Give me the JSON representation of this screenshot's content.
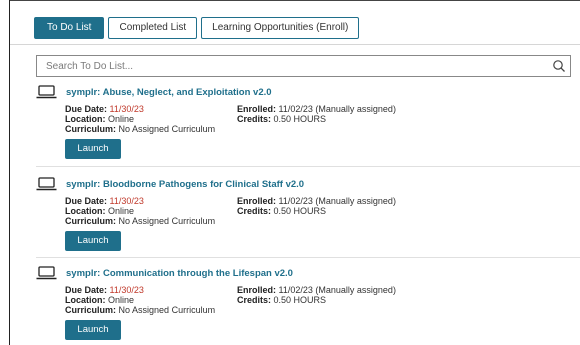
{
  "tabs": [
    {
      "label": "To Do List",
      "active": true
    },
    {
      "label": "Completed List",
      "active": false
    },
    {
      "label": "Learning Opportunities (Enroll)",
      "active": false
    }
  ],
  "search": {
    "placeholder": "Search To Do List..."
  },
  "labels": {
    "due_date": "Due Date:",
    "location": "Location:",
    "curriculum": "Curriculum:",
    "enrolled": "Enrolled:",
    "credits": "Credits:"
  },
  "courses": [
    {
      "title": "symplr: Abuse, Neglect, and Exploitation v2.0",
      "due_date": "11/30/23",
      "location": "Online",
      "curriculum": "No Assigned Curriculum",
      "enrolled": "11/02/23 (Manually assigned)",
      "credits": "0.50 HOURS",
      "button": "Launch"
    },
    {
      "title": "symplr: Bloodborne Pathogens for Clinical Staff v2.0",
      "due_date": "11/30/23",
      "location": "Online",
      "curriculum": "No Assigned Curriculum",
      "enrolled": "11/02/23 (Manually assigned)",
      "credits": "0.50 HOURS",
      "button": "Launch"
    },
    {
      "title": "symplr: Communication through the Lifespan v2.0",
      "due_date": "11/30/23",
      "location": "Online",
      "curriculum": "No Assigned Curriculum",
      "enrolled": "11/02/23 (Manually assigned)",
      "credits": "0.50 HOURS",
      "button": "Launch"
    }
  ],
  "colors": {
    "accent": "#1f6f8b",
    "due": "#c0392b"
  },
  "icons": {
    "course": "laptop-icon",
    "search": "search-icon"
  }
}
